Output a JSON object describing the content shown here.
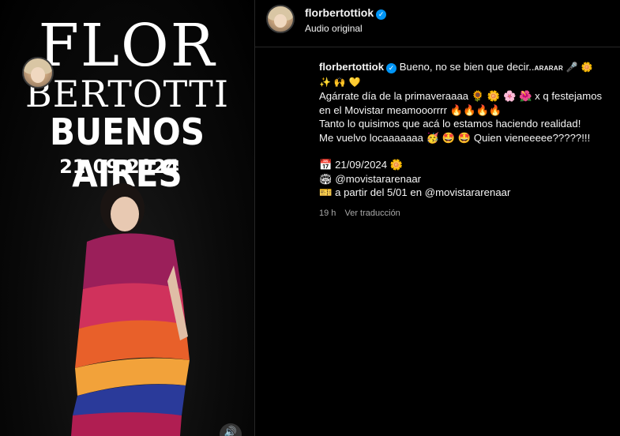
{
  "media": {
    "poster": {
      "line1": "FLOR",
      "line2": "BERTOTTI",
      "line3": "BUENOS AIRES",
      "line4": "21.09.2024"
    },
    "mute_icon": "speaker-icon"
  },
  "header": {
    "username": "florbertottiok",
    "audio": "Audio original"
  },
  "caption": {
    "username": "florbertottiok",
    "line1_text": "Bueno, no se bien que decir..",
    "line1_small": "ARARAR",
    "line1_emojis": "🎤 🌼",
    "line2": "✨ 🙌 💛",
    "line3": "Agárrate día de la primaveraaaa 🌻 🌼 🌸 🌺 x q festejamos",
    "line4": "en el Movistar meamooorrrr 🔥🔥🔥🔥",
    "line5": "Tanto lo quisimos que acá lo estamos haciendo realidad!",
    "line6": "Me vuelvo locaaaaaaa 🥳 🤩 🤩 Quien vieneeeee?????!!!",
    "date_line": "📅 21/09/2024 🌼",
    "venue_line": "🏟 @movistararenaar",
    "tickets_line": "🎫 a partir del 5/01 en @movistararenaar"
  },
  "meta": {
    "time_ago": "19 h",
    "translate": "Ver traducción"
  },
  "colors": {
    "background": "#000000",
    "verified": "#0095f6",
    "muted_text": "#a8a8a8"
  }
}
